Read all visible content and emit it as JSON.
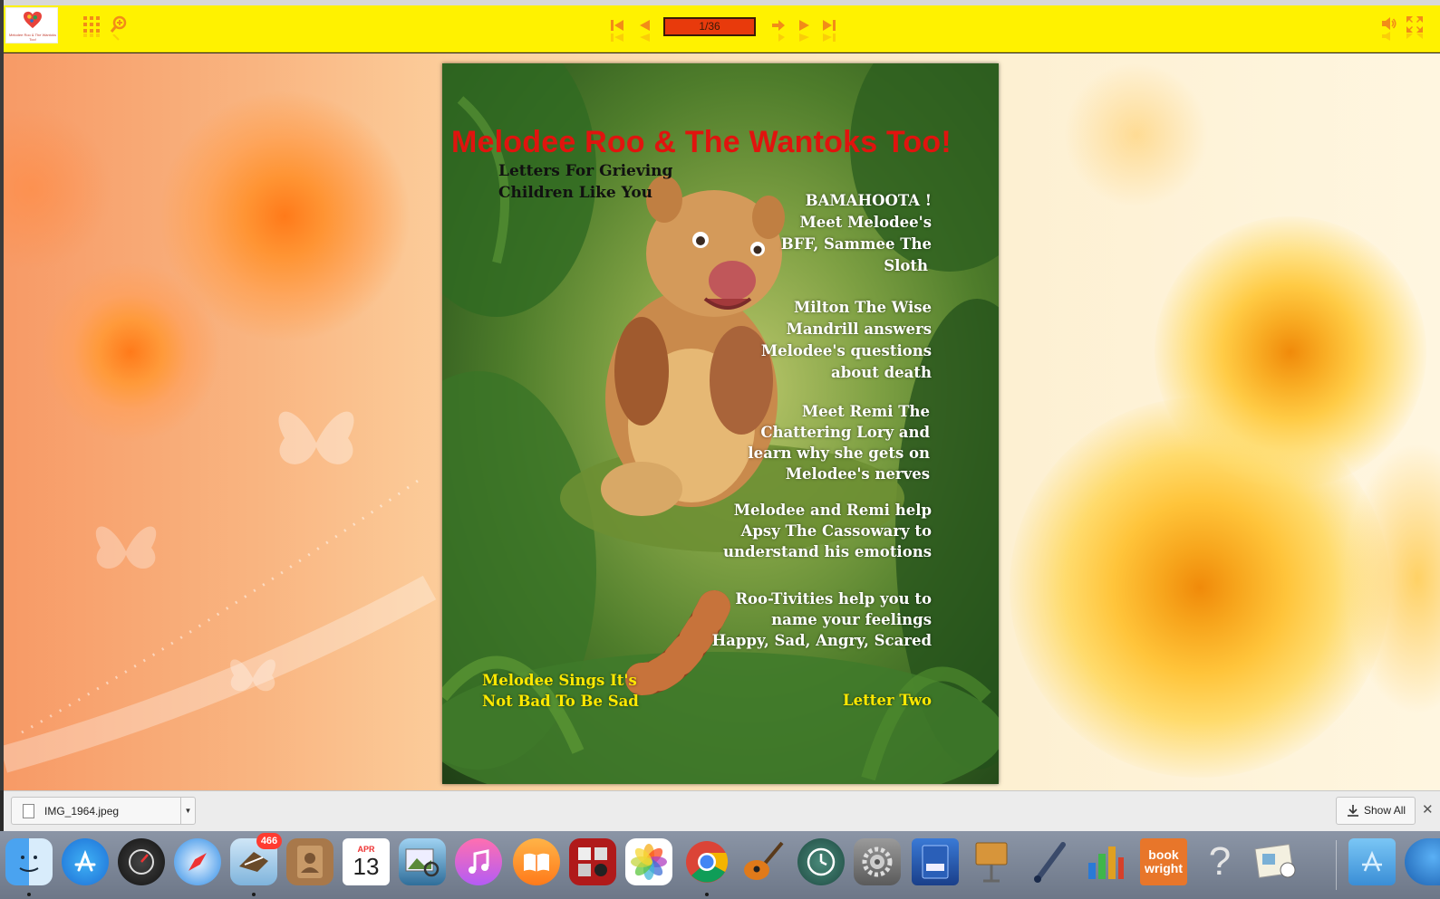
{
  "toolbar": {
    "logo_text": "Melodee Roo & The Wantoks Too!",
    "page_indicator": "1/36",
    "icons": [
      "thumbnails-icon",
      "zoom-icon",
      "first-page-icon",
      "previous-page-icon",
      "next-page-icon",
      "play-icon",
      "last-page-icon",
      "sound-icon",
      "fullscreen-icon"
    ]
  },
  "cover": {
    "title": "Melodee Roo & The Wantoks Too!",
    "subtitle_line1": "Letters For Grieving",
    "subtitle_line2": "Children Like You",
    "blurb1": [
      "BAMAHOOTA !",
      "Meet Melodee's",
      "BFF, Sammee The",
      "Sloth"
    ],
    "blurb2": [
      "Milton The Wise",
      "Mandrill answers",
      "Melodee's questions",
      "about death"
    ],
    "blurb3": [
      "Meet Remi The",
      "Chattering Lory and",
      "learn why she gets on",
      "Melodee's nerves"
    ],
    "blurb4": [
      "Melodee and Remi help",
      "Apsy The Cassowary to",
      "understand his emotions"
    ],
    "blurb5": [
      "Roo-Tivities help you to",
      "name your feelings",
      "Happy, Sad, Angry, Scared"
    ],
    "bottom_left": [
      "Melodee Sings It's",
      "Not Bad To Be Sad"
    ],
    "bottom_right": "Letter Two",
    "colors": {
      "title": "#e0140e",
      "highlight": "#ffe800",
      "toolbar": "#fff200"
    }
  },
  "downloads": {
    "file_name": "IMG_1964.jpeg",
    "show_all": "Show All",
    "close": "✕"
  },
  "dock": {
    "mail_badge": "466",
    "calendar_month": "APR",
    "calendar_day": "13",
    "bookwright_line1": "book",
    "bookwright_line2": "wright",
    "apps": [
      "Finder",
      "App Store",
      "Dashboard",
      "Safari",
      "Mail",
      "Contacts",
      "Calendar",
      "Preview",
      "iTunes",
      "iBooks",
      "Photo Booth",
      "Photos",
      "Chrome",
      "GarageBand",
      "Time Machine",
      "System Preferences",
      "eFlip Professional",
      "Keynote",
      "Script Editor",
      "Charts",
      "BookWright",
      "Help",
      "Preview 3D",
      "Applications",
      "Network"
    ]
  }
}
